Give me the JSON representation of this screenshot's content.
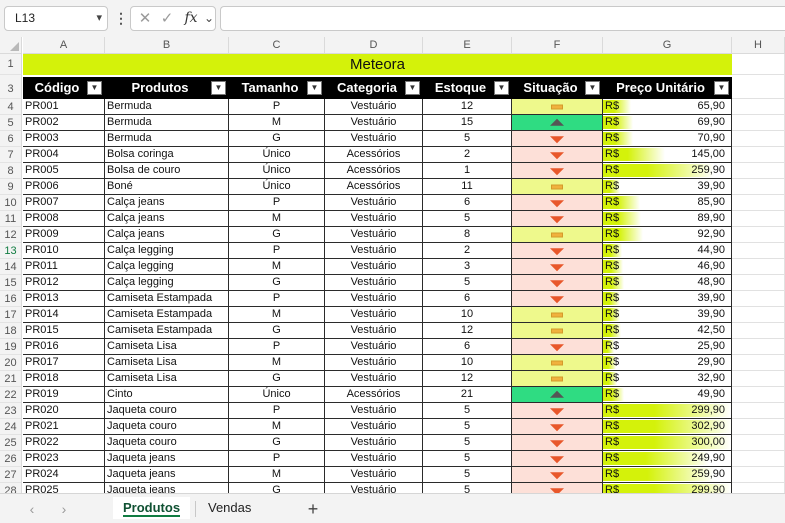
{
  "formula_bar": {
    "name_box": "L13",
    "name_box_arrow": "▾",
    "menu_dots": "⋮",
    "cancel_glyph": "✕",
    "enter_glyph": "✓",
    "fx_label": "fx",
    "fx_arrow": "⌄",
    "formula": ""
  },
  "columns": [
    "A",
    "B",
    "C",
    "D",
    "E",
    "F",
    "G",
    "H"
  ],
  "rows": [
    "1",
    "3",
    "4",
    "5",
    "6",
    "7",
    "8",
    "9",
    "10",
    "11",
    "12",
    "13",
    "14",
    "15",
    "16",
    "17",
    "18",
    "19",
    "20",
    "21",
    "22",
    "23",
    "24",
    "25",
    "26",
    "27",
    "28"
  ],
  "selected_row": "13",
  "banner": "Meteora",
  "headers": [
    "Código",
    "Produtos",
    "Tamanho",
    "Categoria",
    "Estoque",
    "Situação",
    "Preço Unitário"
  ],
  "filter_glyph": "▼",
  "currency": "R$",
  "status_colors": {
    "down": "#fde0d8",
    "same": "#eef98c",
    "up": "#2fdc82"
  },
  "price_bar_color": "#d4f20a",
  "price_max": 302.9,
  "products": [
    {
      "code": "PR001",
      "product": "Bermuda",
      "size": "P",
      "category": "Vestuário",
      "stock": "12",
      "status": "same",
      "price": "65,90",
      "price_value": 65.9
    },
    {
      "code": "PR002",
      "product": "Bermuda",
      "size": "M",
      "category": "Vestuário",
      "stock": "15",
      "status": "up",
      "price": "69,90",
      "price_value": 69.9
    },
    {
      "code": "PR003",
      "product": "Bermuda",
      "size": "G",
      "category": "Vestuário",
      "stock": "5",
      "status": "down",
      "price": "70,90",
      "price_value": 70.9
    },
    {
      "code": "PR004",
      "product": "Bolsa coringa",
      "size": "Único",
      "category": "Acessórios",
      "stock": "2",
      "status": "down",
      "price": "145,00",
      "price_value": 145.0
    },
    {
      "code": "PR005",
      "product": "Bolsa de couro",
      "size": "Único",
      "category": "Acessórios",
      "stock": "1",
      "status": "down",
      "price": "259,90",
      "price_value": 259.9
    },
    {
      "code": "PR006",
      "product": "Boné",
      "size": "Único",
      "category": "Acessórios",
      "stock": "11",
      "status": "same",
      "price": "39,90",
      "price_value": 39.9
    },
    {
      "code": "PR007",
      "product": "Calça jeans",
      "size": "P",
      "category": "Vestuário",
      "stock": "6",
      "status": "down",
      "price": "85,90",
      "price_value": 85.9
    },
    {
      "code": "PR008",
      "product": "Calça jeans",
      "size": "M",
      "category": "Vestuário",
      "stock": "5",
      "status": "down",
      "price": "89,90",
      "price_value": 89.9
    },
    {
      "code": "PR009",
      "product": "Calça jeans",
      "size": "G",
      "category": "Vestuário",
      "stock": "8",
      "status": "same",
      "price": "92,90",
      "price_value": 92.9
    },
    {
      "code": "PR010",
      "product": "Calça legging",
      "size": "P",
      "category": "Vestuário",
      "stock": "2",
      "status": "down",
      "price": "44,90",
      "price_value": 44.9
    },
    {
      "code": "PR011",
      "product": "Calça legging",
      "size": "M",
      "category": "Vestuário",
      "stock": "3",
      "status": "down",
      "price": "46,90",
      "price_value": 46.9
    },
    {
      "code": "PR012",
      "product": "Calça legging",
      "size": "G",
      "category": "Vestuário",
      "stock": "5",
      "status": "down",
      "price": "48,90",
      "price_value": 48.9
    },
    {
      "code": "PR013",
      "product": "Camiseta Estampada",
      "size": "P",
      "category": "Vestuário",
      "stock": "6",
      "status": "down",
      "price": "39,90",
      "price_value": 39.9
    },
    {
      "code": "PR014",
      "product": "Camiseta Estampada",
      "size": "M",
      "category": "Vestuário",
      "stock": "10",
      "status": "same",
      "price": "39,90",
      "price_value": 39.9
    },
    {
      "code": "PR015",
      "product": "Camiseta Estampada",
      "size": "G",
      "category": "Vestuário",
      "stock": "12",
      "status": "same",
      "price": "42,50",
      "price_value": 42.5
    },
    {
      "code": "PR016",
      "product": "Camiseta Lisa",
      "size": "P",
      "category": "Vestuário",
      "stock": "6",
      "status": "down",
      "price": "25,90",
      "price_value": 25.9
    },
    {
      "code": "PR017",
      "product": "Camiseta Lisa",
      "size": "M",
      "category": "Vestuário",
      "stock": "10",
      "status": "same",
      "price": "29,90",
      "price_value": 29.9
    },
    {
      "code": "PR018",
      "product": "Camiseta Lisa",
      "size": "G",
      "category": "Vestuário",
      "stock": "12",
      "status": "same",
      "price": "32,90",
      "price_value": 32.9
    },
    {
      "code": "PR019",
      "product": "Cinto",
      "size": "Único",
      "category": "Acessórios",
      "stock": "21",
      "status": "up",
      "price": "49,90",
      "price_value": 49.9
    },
    {
      "code": "PR020",
      "product": "Jaqueta couro",
      "size": "P",
      "category": "Vestuário",
      "stock": "5",
      "status": "down",
      "price": "299,90",
      "price_value": 299.9
    },
    {
      "code": "PR021",
      "product": "Jaqueta couro",
      "size": "M",
      "category": "Vestuário",
      "stock": "5",
      "status": "down",
      "price": "302,90",
      "price_value": 302.9
    },
    {
      "code": "PR022",
      "product": "Jaqueta couro",
      "size": "G",
      "category": "Vestuário",
      "stock": "5",
      "status": "down",
      "price": "300,00",
      "price_value": 300.0
    },
    {
      "code": "PR023",
      "product": "Jaqueta jeans",
      "size": "P",
      "category": "Vestuário",
      "stock": "5",
      "status": "down",
      "price": "249,90",
      "price_value": 249.9
    },
    {
      "code": "PR024",
      "product": "Jaqueta jeans",
      "size": "M",
      "category": "Vestuário",
      "stock": "5",
      "status": "down",
      "price": "259,90",
      "price_value": 259.9
    },
    {
      "code": "PR025",
      "product": "Jaqueta jeans",
      "size": "G",
      "category": "Vestuário",
      "stock": "5",
      "status": "down",
      "price": "299,90",
      "price_value": 299.9
    }
  ],
  "sheet_nav": {
    "prev": "‹",
    "next": "›",
    "add": "+"
  },
  "sheets": [
    {
      "name": "Produtos",
      "active": true
    },
    {
      "name": "Vendas",
      "active": false
    }
  ]
}
